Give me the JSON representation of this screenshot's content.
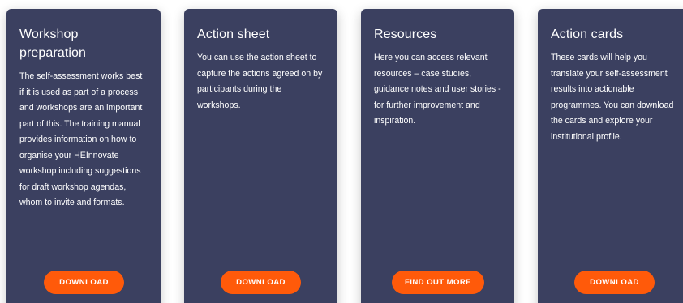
{
  "cards": [
    {
      "title": "Workshop preparation",
      "text": "The self-assessment works best if it is used as part of a process and workshops are an important part of this. The training manual provides information on how to organise your HEInnovate workshop including suggestions for draft workshop agendas, whom to invite and formats.",
      "button": "DOWNLOAD"
    },
    {
      "title": "Action sheet",
      "text": "You can use the action sheet to capture the actions agreed on by participants during the workshops.",
      "button": "DOWNLOAD"
    },
    {
      "title": "Resources",
      "text": "Here you can access relevant resources – case studies, guidance notes and user stories - for further improvement and inspiration.",
      "button": "FIND OUT MORE"
    },
    {
      "title": "Action cards",
      "text": "These cards will help you translate your self-assessment results into actionable programmes. You can download the cards and explore your institutional profile.",
      "button": "DOWNLOAD"
    }
  ],
  "colors": {
    "card_background": "#3b4060",
    "button_background": "#ff5a0a",
    "text": "#ffffff"
  }
}
